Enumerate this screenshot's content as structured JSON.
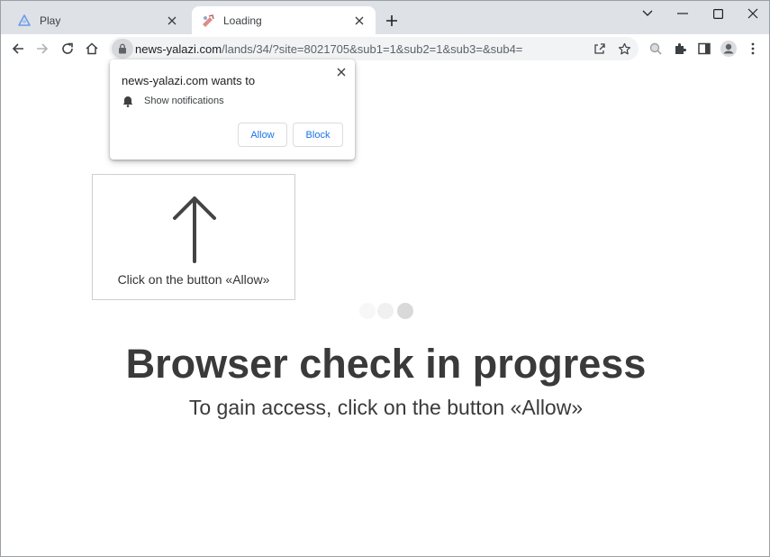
{
  "tabs": [
    {
      "title": "Play",
      "favicon": "play-favicon-icon",
      "active": false
    },
    {
      "title": "Loading",
      "favicon": "loading-favicon-icon",
      "active": true
    }
  ],
  "window_controls": [
    "chevron-down-icon",
    "minimize-icon",
    "maximize-icon",
    "close-icon"
  ],
  "toolbar": {
    "url_host": "news-yalazi.com",
    "url_path": "/lands/34/?site=8021705&sub1=1&sub2=1&sub3=&sub4="
  },
  "popup": {
    "title": "news-yalazi.com wants to",
    "permission": "Show notifications",
    "allow": "Allow",
    "block": "Block"
  },
  "page": {
    "hint": "Click on the button «Allow»",
    "headline": "Browser check in progress",
    "subline": "To gain access, click on the button «Allow»"
  },
  "colors": {
    "tabstrip": "#dee1e6",
    "omnibox": "#f1f3f4",
    "button_text": "#1a73e8",
    "headline": "#3a3a3a"
  }
}
